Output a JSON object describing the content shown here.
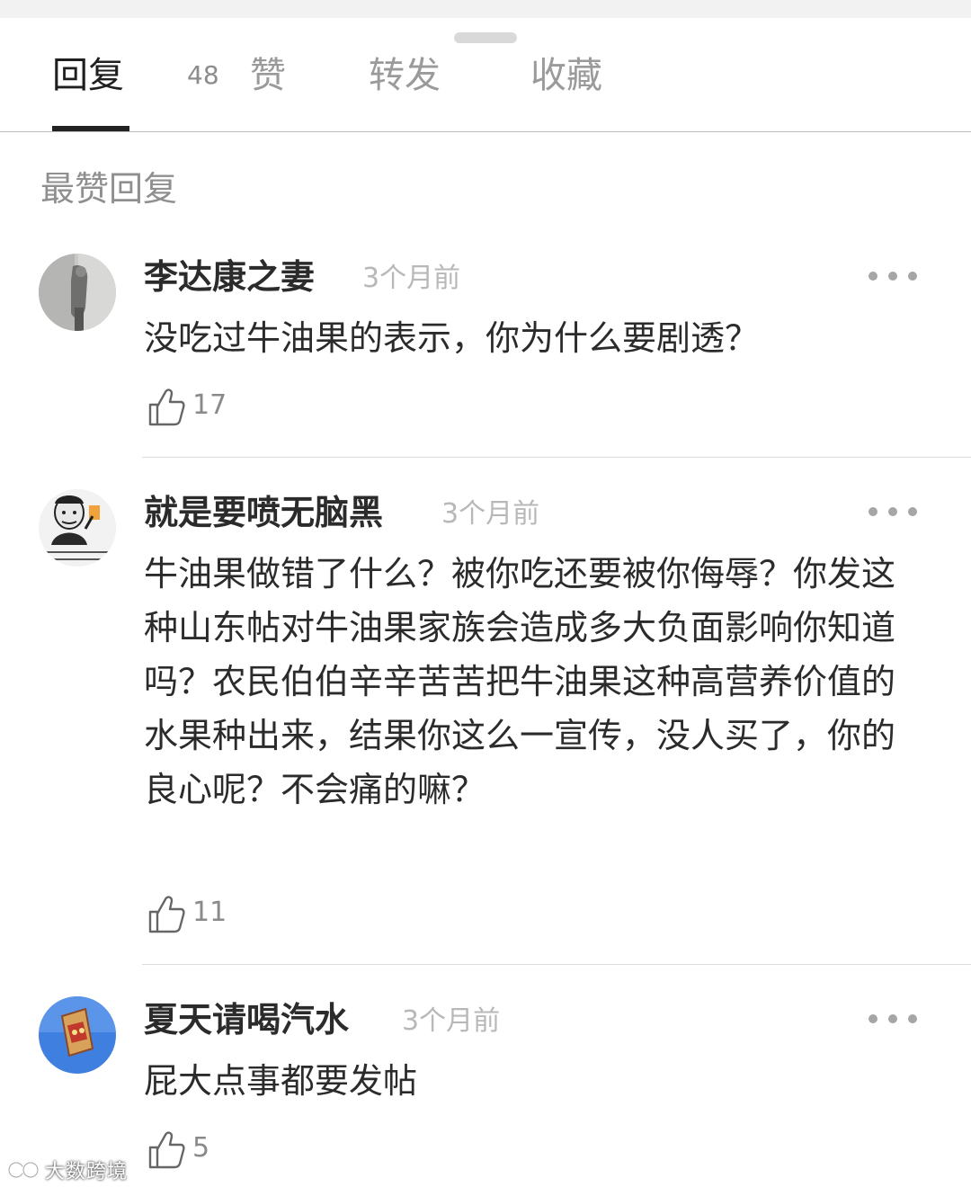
{
  "tabs": [
    {
      "label": "回复",
      "count": "48",
      "active": true
    },
    {
      "label": "赞",
      "active": false
    },
    {
      "label": "转发",
      "active": false
    },
    {
      "label": "收藏",
      "active": false
    }
  ],
  "section_title": "最赞回复",
  "comments": [
    {
      "username": "李达康之妻",
      "time": "3个月前",
      "content": "没吃过牛油果的表示，你为什么要剧透？",
      "likes": "17",
      "avatar": "photo-avatar-icon"
    },
    {
      "username": "就是要喷无脑黑",
      "time": "3个月前",
      "content": "牛油果做错了什么？被你吃还要被你侮辱？你发这种山东帖对牛油果家族会造成多大负面影响你知道吗？农民伯伯辛辛苦苦把牛油果这种高营养价值的水果种出来，结果你这么一宣传，没人买了，你的良心呢？不会痛的嘛？",
      "likes": "11",
      "avatar": "meme-avatar-icon"
    },
    {
      "username": "夏天请喝汽水",
      "time": "3个月前",
      "content": "屁大点事都要发帖",
      "likes": "5",
      "avatar": "blue-sky-avatar-icon"
    }
  ],
  "watermark": "大数跨境",
  "colors": {
    "active_tab": "#1f1f1f",
    "inactive_tab": "#9a9a9a",
    "timestamp": "#b8b8b8",
    "divider": "#dcdcdc",
    "avatar_blue": "#3f7fe0"
  }
}
